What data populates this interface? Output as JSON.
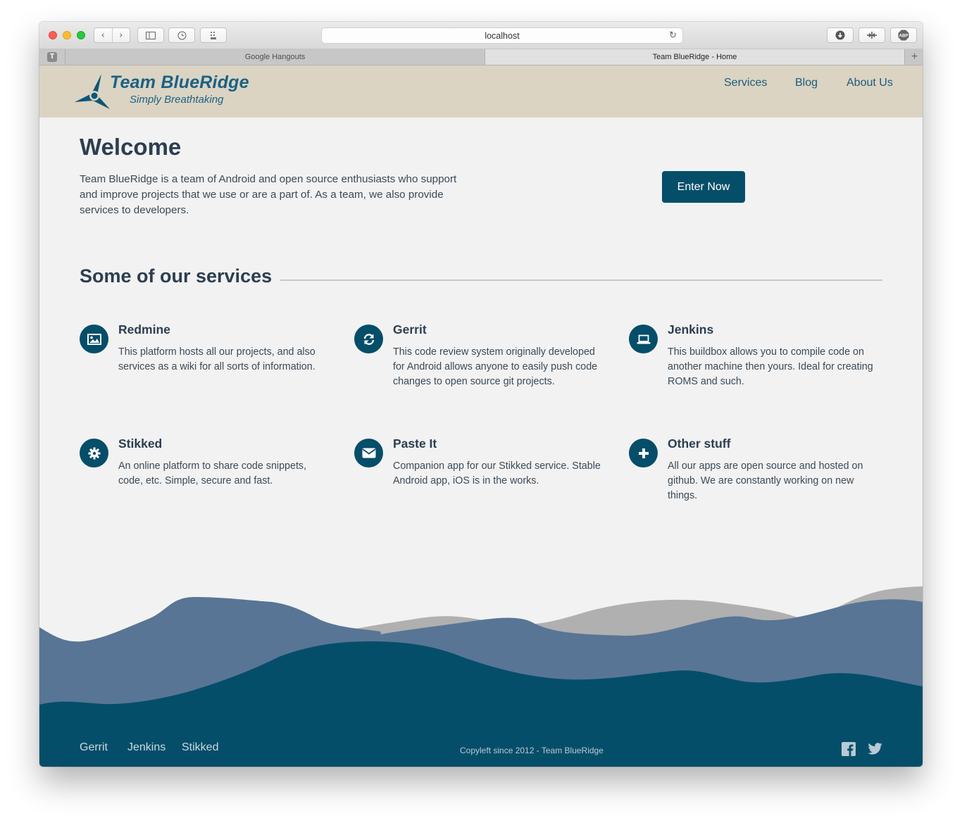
{
  "browser": {
    "url": "localhost",
    "tabs": [
      {
        "label": "Google Hangouts",
        "active": false
      },
      {
        "label": "Team BlueRidge - Home",
        "active": true
      }
    ],
    "pinned_tab_letter": "T"
  },
  "header": {
    "title": "Team BlueRidge",
    "tagline": "Simply Breathtaking",
    "nav": [
      "Services",
      "Blog",
      "About Us"
    ]
  },
  "hero": {
    "heading": "Welcome",
    "text": "Team BlueRidge is a team of Android and open source enthusiasts who support and improve projects that we use or are a part of. As a team, we also provide services to developers.",
    "button": "Enter Now"
  },
  "services": {
    "heading": "Some of our services",
    "items": [
      {
        "name": "Redmine",
        "description": "This platform hosts all our projects, and also services as a wiki for all sorts of information.",
        "icon": "image-icon"
      },
      {
        "name": "Gerrit",
        "description": "This code review system originally developed for Android allows anyone to easily push code changes to open source git projects.",
        "icon": "refresh-icon"
      },
      {
        "name": "Jenkins",
        "description": "This buildbox allows you to compile code on another machine then yours. Ideal for creating ROMS and such.",
        "icon": "laptop-icon"
      },
      {
        "name": "Stikked",
        "description": "An online platform to share code snippets, code, etc. Simple, secure and fast.",
        "icon": "gear-icon"
      },
      {
        "name": "Paste It",
        "description": "Companion app for our Stikked service. Stable Android app, iOS is in the works.",
        "icon": "envelope-icon"
      },
      {
        "name": "Other stuff",
        "description": "All our apps are open source and hosted on github. We are constantly working on new things.",
        "icon": "plus-icon"
      }
    ]
  },
  "footer": {
    "links": [
      "Gerrit",
      "Jenkins",
      "Stikked"
    ],
    "copyright": "Copyleft since 2012 - Team BlueRidge",
    "social": [
      "facebook-icon",
      "twitter-icon"
    ]
  },
  "colors": {
    "primary": "#054e69",
    "header_bg": "#dbd4c2",
    "page_bg": "#f2f2f2",
    "hill_mid": "#587595",
    "hill_back": "#b0b0b0"
  }
}
